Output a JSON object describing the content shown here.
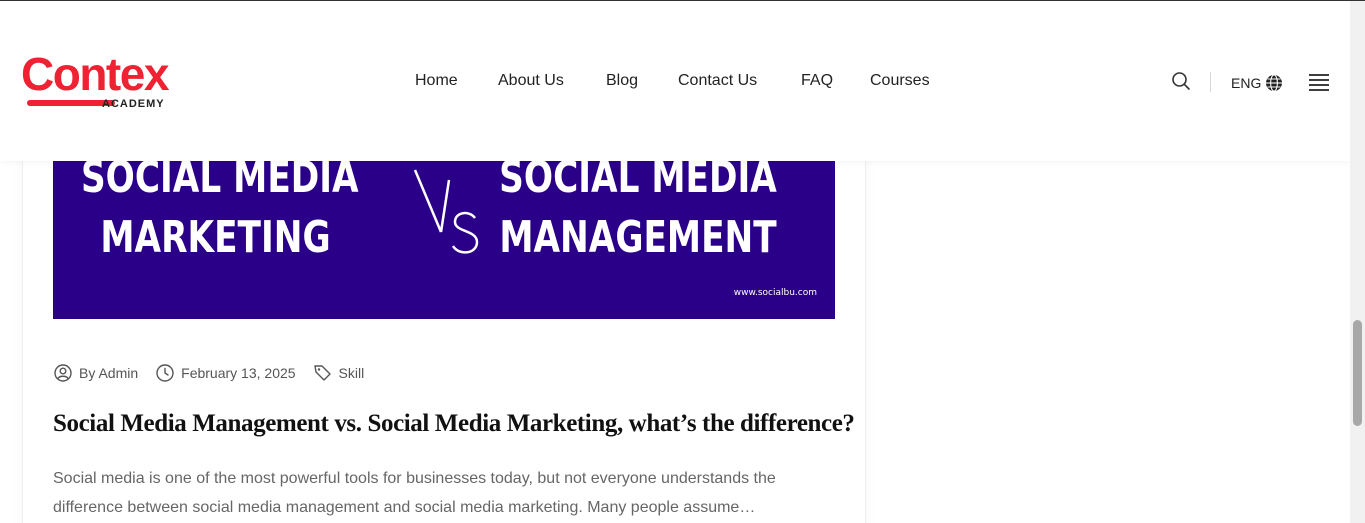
{
  "logo": {
    "word": "Contex",
    "sub": "ACADEMY"
  },
  "nav": {
    "items": [
      {
        "label": "Home"
      },
      {
        "label": "About Us"
      },
      {
        "label": "Blog"
      },
      {
        "label": "Contact Us"
      },
      {
        "label": "FAQ"
      },
      {
        "label": "Courses"
      }
    ]
  },
  "header_tools": {
    "language": "ENG",
    "search_icon": "search-icon",
    "globe_icon": "globe-icon",
    "menu_icon": "hamburger-menu-icon"
  },
  "banner": {
    "left_text_line1": "SOCIAL MEDIA",
    "left_text_line2": "MARKETING",
    "right_text_line1": "SOCIAL MEDIA",
    "right_text_line2": "MANAGEMENT",
    "url": "www.socialbu.com",
    "background": "#2a0088"
  },
  "post": {
    "author": "By Admin",
    "date": "February 13, 2025",
    "category": "Skill",
    "title": "Social Media Management vs. Social Media Marketing, what’s the difference?",
    "excerpt": "Social media is one of the most powerful tools for businesses today, but not everyone understands the difference between social media management and social media marketing. Many people assume…"
  },
  "colors": {
    "brand": "#ee2233"
  }
}
